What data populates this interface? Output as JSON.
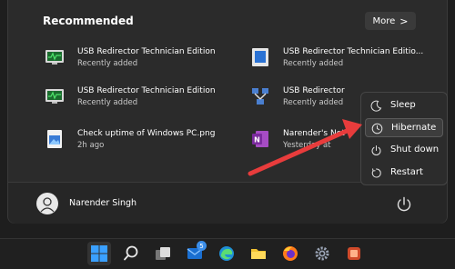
{
  "start_menu": {
    "recommended_title": "Recommended",
    "more_button": {
      "label": "More",
      "chevron": ">"
    },
    "items": [
      {
        "name": "USB Redirector Technician Edition",
        "sub": "Recently added",
        "icon": "usb-redirector-monitor-icon"
      },
      {
        "name": "USB Redirector Technician Editio...",
        "sub": "Recently added",
        "icon": "usb-redirector-app-icon"
      },
      {
        "name": "USB Redirector Technician Edition",
        "sub": "Recently added",
        "icon": "usb-redirector-monitor-icon"
      },
      {
        "name": "USB Redirector",
        "sub": "Recently added",
        "icon": "usb-redirector-network-icon"
      },
      {
        "name": "Check uptime of Windows PC.png",
        "sub": "2h ago",
        "icon": "image-file-icon"
      },
      {
        "name": "Narender's Not",
        "sub": "Yesterday at",
        "icon": "onenote-icon"
      }
    ],
    "user": {
      "name": "Narender Singh"
    },
    "power_menu": [
      {
        "label": "Sleep",
        "icon": "moon-icon"
      },
      {
        "label": "Hibernate",
        "icon": "clock-icon"
      },
      {
        "label": "Shut down",
        "icon": "power-icon"
      },
      {
        "label": "Restart",
        "icon": "restart-icon"
      }
    ]
  },
  "taskbar": {
    "items": [
      {
        "name": "start-button",
        "icon": "windows-logo-icon"
      },
      {
        "name": "search-button",
        "icon": "search-icon"
      },
      {
        "name": "task-view-button",
        "icon": "task-view-icon"
      },
      {
        "name": "mail-app",
        "icon": "mail-icon",
        "badge": "5"
      },
      {
        "name": "edge-browser",
        "icon": "edge-icon"
      },
      {
        "name": "file-explorer",
        "icon": "folder-icon"
      },
      {
        "name": "firefox-browser",
        "icon": "firefox-icon"
      },
      {
        "name": "settings-app",
        "icon": "gear-icon"
      },
      {
        "name": "app-extra",
        "icon": "app-icon"
      }
    ]
  },
  "colors": {
    "accent": "#3b8eea",
    "panel": "#2b2b2b",
    "arrow": "#e83c3c"
  }
}
